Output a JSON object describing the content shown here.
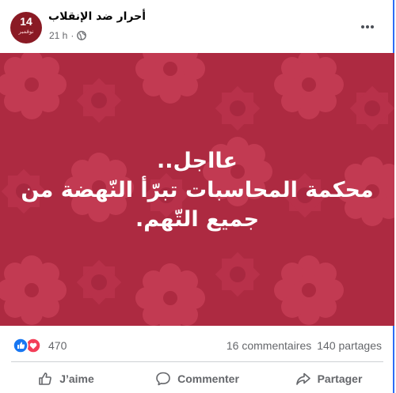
{
  "post": {
    "page_name": "أحرار ضد الإنقلاب",
    "time": "21 h",
    "avatar": {
      "number": "14",
      "subtitle": "نوفمبر"
    },
    "image_text": {
      "line1": "عااجل..",
      "line2": "محكمة المحاسبات تبرّأ النّهضة من",
      "line3": "جميع التّهم."
    },
    "reactions_count": "470",
    "comments": "16 commentaires",
    "shares": "140 partages",
    "actions": {
      "like": "J’aime",
      "comment": "Commenter",
      "share": "Partager"
    }
  },
  "colors": {
    "image_bg": "#ad2a41",
    "pattern": "#c33a52",
    "like_blue": "#1877f2",
    "love_red": "#f33e58",
    "muted_text": "#65676b"
  },
  "icons": [
    "globe-icon",
    "more-options-icon",
    "like-reaction-icon",
    "love-reaction-icon",
    "like-icon",
    "comment-icon",
    "share-icon"
  ]
}
